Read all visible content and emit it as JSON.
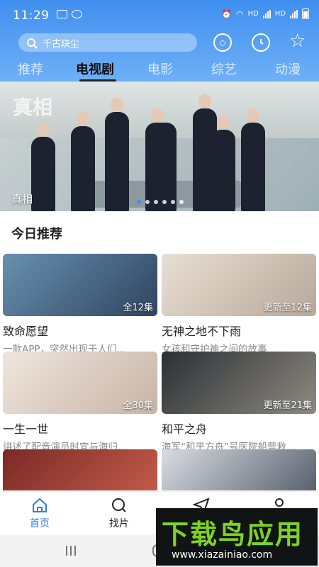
{
  "status_bar": {
    "time": "11:29",
    "network_label_1": "HD",
    "network_label_2": "HD"
  },
  "search": {
    "placeholder": "千古玦尘"
  },
  "header_icons": [
    "scan-icon",
    "history-clock-icon",
    "favorite-star-icon"
  ],
  "tabs": [
    {
      "label": "推荐",
      "active": false
    },
    {
      "label": "电视剧",
      "active": true
    },
    {
      "label": "电影",
      "active": false
    },
    {
      "label": "综艺",
      "active": false
    },
    {
      "label": "动漫",
      "active": false
    }
  ],
  "banner": {
    "caption": "真相",
    "logo_text": "真相",
    "slide_count": 6,
    "active_slide": 1
  },
  "section": {
    "title": "今日推荐"
  },
  "cards": [
    {
      "title": "致命愿望",
      "desc": "一款APP，突然出现于人们...",
      "badge": "全12集"
    },
    {
      "title": "无神之地不下雨",
      "desc": "女孩和守护神之间的故事",
      "badge": "更新至12集"
    },
    {
      "title": "一生一世",
      "desc": "讲述了配音演员时宜与海归...",
      "badge": "全30集"
    },
    {
      "title": "和平之舟",
      "desc": "海军“和平方舟”号医院船营救...",
      "badge": "更新至21集"
    },
    {
      "title": "",
      "desc": "",
      "badge": ""
    },
    {
      "title": "",
      "desc": "",
      "badge": ""
    }
  ],
  "bottom_nav": [
    {
      "label": "首页",
      "active": true
    },
    {
      "label": "找片",
      "active": false
    }
  ],
  "watermark": {
    "title": "下载鸟应用",
    "url": "www.xiazainiao.com"
  },
  "colors": {
    "accent": "#3f8ff0",
    "active_tab": "#111111",
    "watermark_green": "#7ed321"
  }
}
